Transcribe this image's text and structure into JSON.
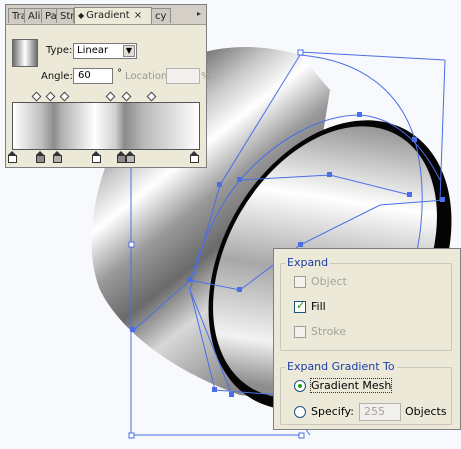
{
  "gradient_panel": {
    "tabs": [
      "Tra",
      "Ali",
      "Pa",
      "Str",
      "Gradient",
      "cy"
    ],
    "active_tab": "Gradient",
    "tab_close": "×",
    "type_label": "Type:",
    "type_value": "Linear",
    "angle_label": "Angle:",
    "angle_value": "60",
    "degree_symbol": "°",
    "location_label": "Location:",
    "location_value": "",
    "percent_symbol": "%",
    "panel_menu_icon": "panel-menu-icon",
    "midpoint_count": 6,
    "color_stop_count": 6
  },
  "expand_dialog": {
    "expand_group_label": "Expand",
    "object_label": "Object",
    "object_checked": false,
    "object_enabled": false,
    "fill_label": "Fill",
    "fill_checked": true,
    "fill_enabled": true,
    "stroke_label": "Stroke",
    "stroke_checked": false,
    "stroke_enabled": false,
    "expand_to_group_label": "Expand Gradient To",
    "gradient_mesh_label": "Gradient Mesh",
    "gradient_mesh_selected": true,
    "specify_label": "Specify:",
    "specify_value": "255",
    "objects_label": "Objects"
  },
  "colors": {
    "selection_blue": "#4a6ee8",
    "dialog_bg": "#ece9d8",
    "legend_blue": "#1b3fa6",
    "check_green": "#218c21"
  }
}
